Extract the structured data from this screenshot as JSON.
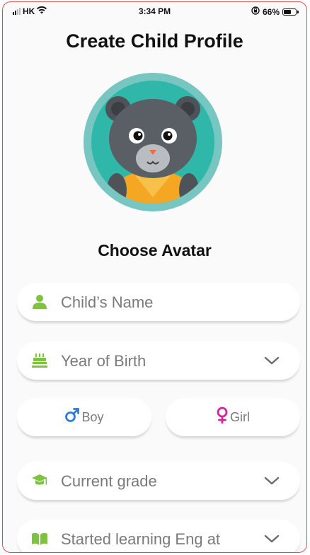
{
  "status_bar": {
    "carrier": "HK",
    "time": "3:34 PM",
    "battery_percent": "66%",
    "battery_level": 0.66
  },
  "header": {
    "title": "Create Child Profile"
  },
  "avatar": {
    "choose_label": "Choose Avatar"
  },
  "form": {
    "name_placeholder": "Child’s Name",
    "birth_year_placeholder": "Year of Birth",
    "gender": {
      "boy_label": "Boy",
      "girl_label": "Girl"
    },
    "grade_placeholder": "Current grade",
    "started_learning_placeholder": "Started learning Eng at"
  },
  "colors": {
    "accent_green": "#7fc242",
    "boy_blue": "#2e7bd6",
    "girl_magenta": "#d5259a",
    "avatar_ring": "#78c6c2",
    "avatar_bg": "#2fb8a9"
  },
  "icons": {
    "name": "person-icon",
    "birth": "cake-icon",
    "boy": "male-symbol-icon",
    "girl": "female-symbol-icon",
    "grade": "graduation-cap-icon",
    "learning": "open-book-icon",
    "dropdown": "chevron-down-icon"
  }
}
